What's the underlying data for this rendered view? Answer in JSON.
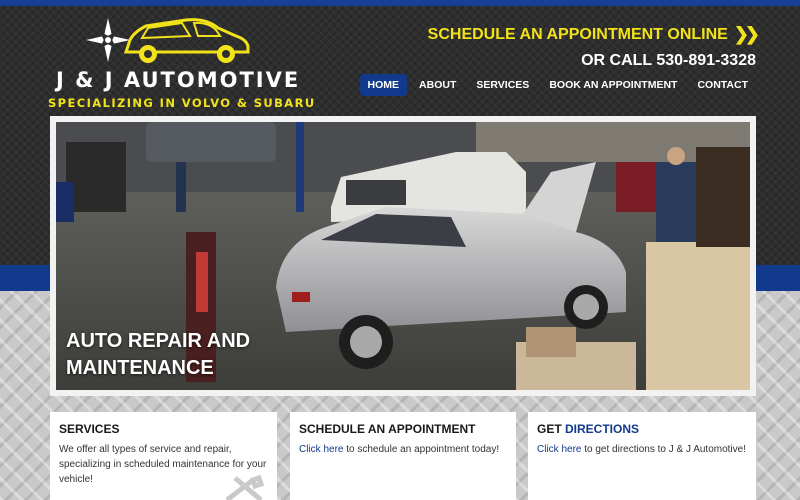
{
  "site": {
    "brand_name": "J & J AUTOMOTIVE",
    "tagline": "SPECIALIZING IN VOLVO & SUBARU"
  },
  "header": {
    "cta_label": "SCHEDULE AN APPOINTMENT ONLINE",
    "phone_label": "OR CALL 530-891-3328"
  },
  "nav": {
    "items": [
      {
        "label": "HOME",
        "active": true
      },
      {
        "label": "ABOUT"
      },
      {
        "label": "SERVICES"
      },
      {
        "label": "BOOK AN APPOINTMENT"
      },
      {
        "label": "CONTACT"
      }
    ]
  },
  "hero": {
    "caption_line1": "AUTO REPAIR AND",
    "caption_line2": "MAINTENANCE"
  },
  "cards": [
    {
      "title": "SERVICES",
      "text": "We offer all types of service and repair, specializing in scheduled maintenance for your vehicle!"
    },
    {
      "title": "SCHEDULE AN APPOINTMENT",
      "link": "Click here",
      "text": " to schedule an appointment today!"
    },
    {
      "title_prefix": "GET ",
      "title_accent": "DIRECTIONS",
      "link": "Click here",
      "text": " to get directions to J & J Automotive!"
    }
  ],
  "colors": {
    "brand_blue": "#123a8c",
    "brand_yellow": "#f2e21a",
    "header_dark": "#2e2e2e"
  },
  "icons": [
    "compass-star-icon",
    "car-logo-icon",
    "double-chevron-right-icon",
    "wrench-tools-icon"
  ]
}
